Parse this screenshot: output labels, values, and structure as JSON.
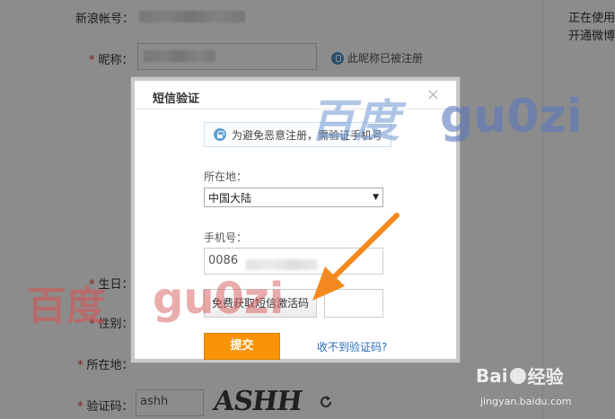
{
  "form": {
    "sina_account_label": "新浪帐号：",
    "nickname_label": "昵称：",
    "nickname_hint": "此昵称已被注册",
    "birthday_label": "生日：",
    "gender_label": "性别：",
    "location_label": "所在地：",
    "captcha_label": "验证码：",
    "captcha_value": "ashh",
    "captcha_image_text": "ASHH",
    "required_mark": "*"
  },
  "side": {
    "line1": "正在使用",
    "line2": "开通微博"
  },
  "modal": {
    "title": "短信验证",
    "close": "×",
    "notice": "为避免恶意注册，需验证手机号",
    "location_label": "所在地：",
    "location_value": "中国大陆",
    "phone_label": "手机号：",
    "phone_prefix": "0086",
    "sms_button": "免费获取短信激活码",
    "submit_button": "提交",
    "no_code_link": "收不到验证码?"
  },
  "watermarks": {
    "top_left": "百度",
    "top_right": "gu0zi",
    "bottom_left": "百度",
    "bottom_right": "gu0zi",
    "brand": "Bai",
    "brand_suffix": "经验",
    "url": "jingyan.baidu.com"
  },
  "colors": {
    "accent_orange": "#f89406",
    "link_blue": "#2b6cb8",
    "required_red": "#e33333"
  }
}
